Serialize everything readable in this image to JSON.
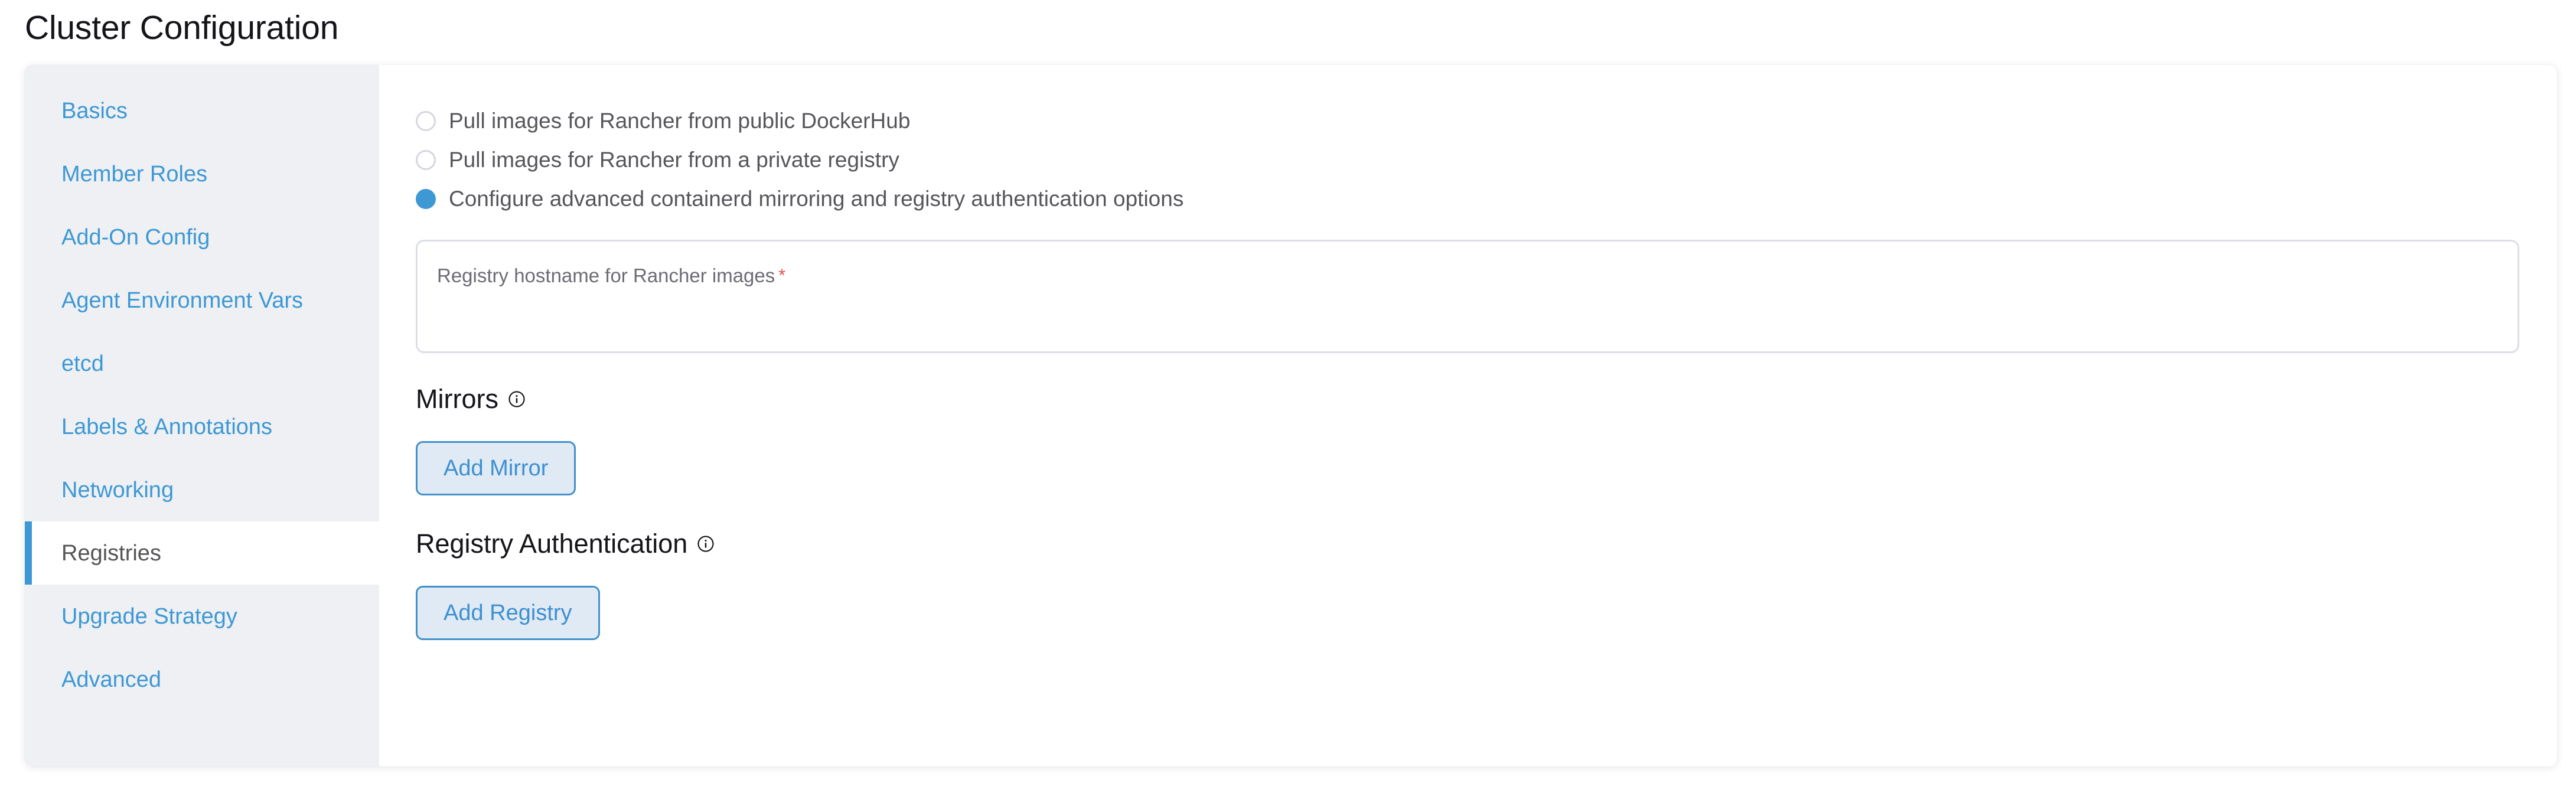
{
  "page": {
    "title": "Cluster Configuration"
  },
  "sidebar": {
    "items": [
      {
        "label": "Basics",
        "active": false
      },
      {
        "label": "Member Roles",
        "active": false
      },
      {
        "label": "Add-On Config",
        "active": false
      },
      {
        "label": "Agent Environment Vars",
        "active": false
      },
      {
        "label": "etcd",
        "active": false
      },
      {
        "label": "Labels & Annotations",
        "active": false
      },
      {
        "label": "Networking",
        "active": false
      },
      {
        "label": "Registries",
        "active": true
      },
      {
        "label": "Upgrade Strategy",
        "active": false
      },
      {
        "label": "Advanced",
        "active": false
      }
    ]
  },
  "content": {
    "registry_source": {
      "options": [
        {
          "label": "Pull images for Rancher from public DockerHub",
          "selected": false
        },
        {
          "label": "Pull images for Rancher from a private registry",
          "selected": false
        },
        {
          "label": "Configure advanced containerd mirroring and registry authentication options",
          "selected": true
        }
      ]
    },
    "registry_hostname_field": {
      "label": "Registry hostname for Rancher images",
      "required_marker": "*",
      "value": "",
      "placeholder": ""
    },
    "mirrors_section": {
      "heading": "Mirrors",
      "info_icon": "info-circle-icon",
      "add_button_label": "Add Mirror"
    },
    "registry_auth_section": {
      "heading": "Registry Authentication",
      "info_icon": "info-circle-icon",
      "add_button_label": "Add Registry"
    }
  },
  "colors": {
    "accent_blue": "#3d98d3",
    "sidebar_bg": "#eef0f4",
    "required_red": "#e1504a",
    "button_fill": "#e0eaf4",
    "button_border": "#4291ca",
    "text_dark": "#141419",
    "text_muted": "#55555b"
  }
}
